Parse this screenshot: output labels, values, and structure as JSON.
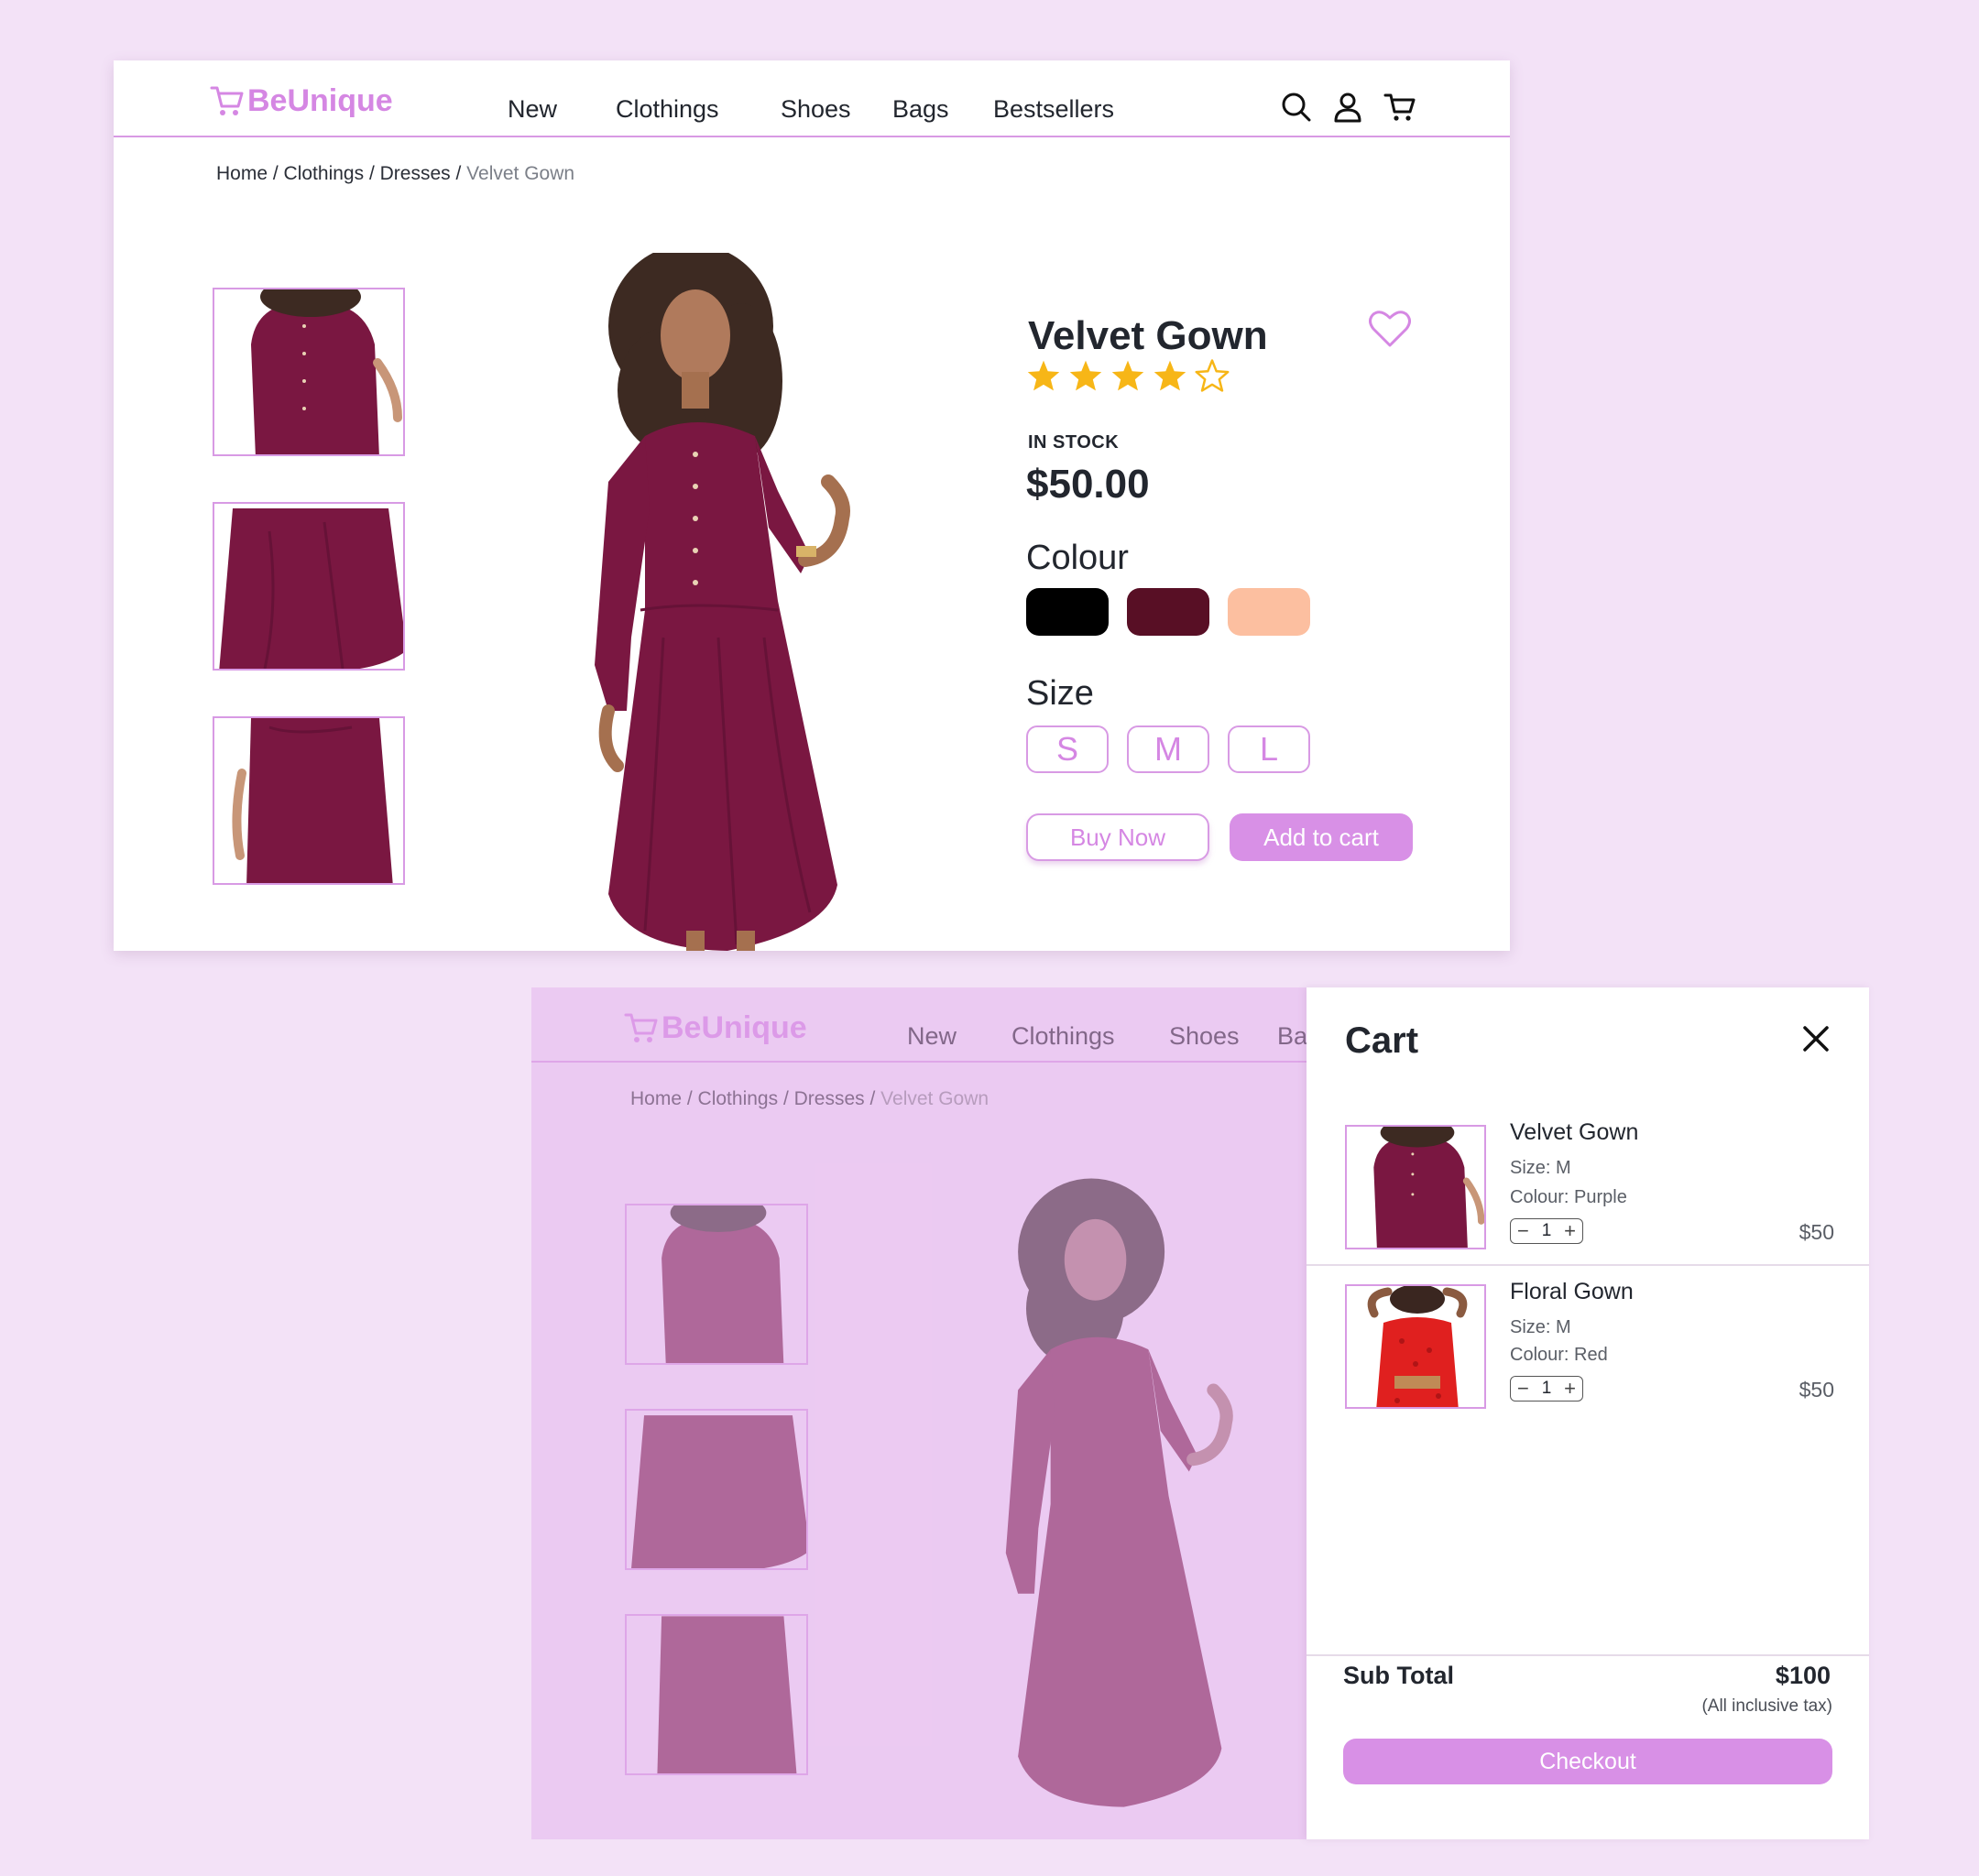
{
  "brand": {
    "name": "BeUnique",
    "accent": "#d587e3"
  },
  "nav": {
    "items": [
      "New",
      "Clothings",
      "Shoes",
      "Bags",
      "Bestsellers"
    ],
    "icons": [
      "search-icon",
      "user-icon",
      "cart-icon"
    ]
  },
  "nav_faded": {
    "items": [
      "New",
      "Clothings",
      "Shoes",
      "Ba"
    ]
  },
  "breadcrumb": {
    "home": "Home",
    "sep": " / ",
    "category": "Clothings",
    "sub": "Dresses",
    "current": "Velvet Gown"
  },
  "product": {
    "name": "Velvet Gown",
    "rating": 4,
    "rating_max": 5,
    "stock": "IN STOCK",
    "price": "$50.00",
    "colour_label": "Colour",
    "colours": [
      "#000000",
      "#580f25",
      "#fcbfa0"
    ],
    "size_label": "Size",
    "sizes": [
      "S",
      "M",
      "L"
    ],
    "buy_now": "Buy Now",
    "add_to_cart": "Add to cart"
  },
  "cart": {
    "title": "Cart",
    "items": [
      {
        "name": "Velvet Gown",
        "size": "Size: M",
        "colour": "Colour: Purple",
        "qty": "1",
        "price": "$50"
      },
      {
        "name": "Floral Gown",
        "size": "Size: M",
        "colour": "Colour: Red",
        "qty": "1",
        "price": "$50"
      }
    ],
    "subtotal_label": "Sub Total",
    "subtotal": "$100",
    "tax_note": "(All inclusive tax)",
    "checkout": "Checkout"
  }
}
